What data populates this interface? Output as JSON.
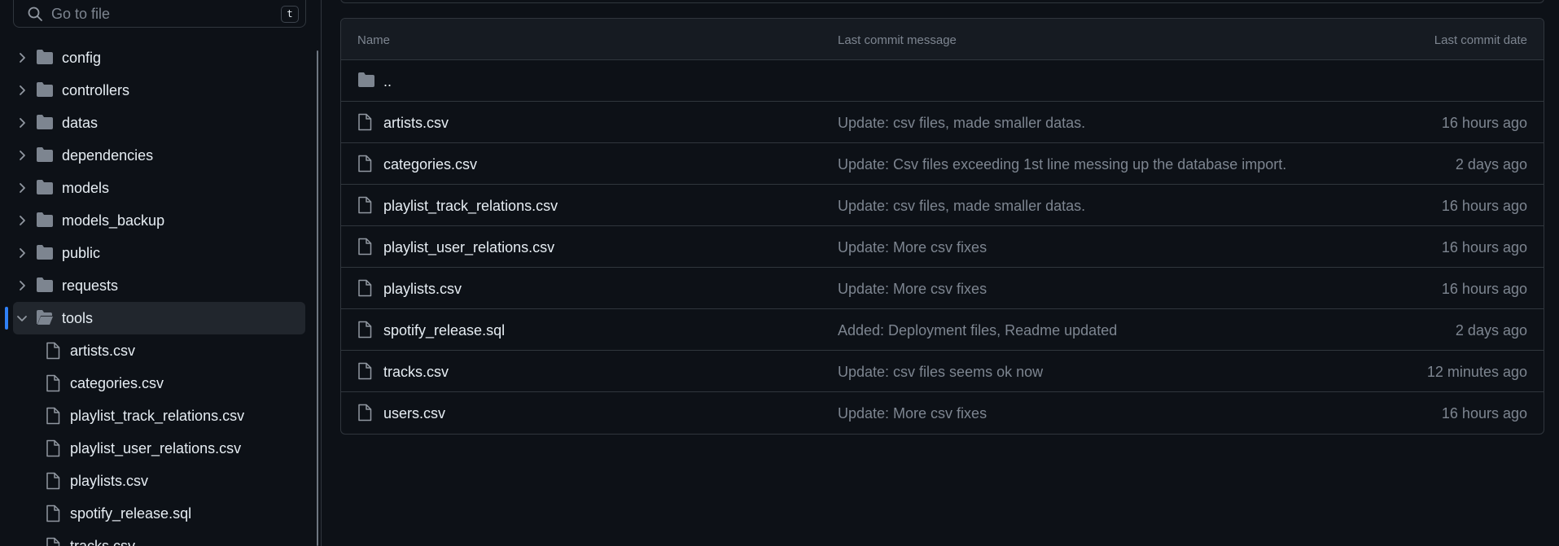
{
  "sidebar": {
    "search": {
      "placeholder": "Go to file",
      "shortcut": "t"
    },
    "folders": [
      {
        "label": "config"
      },
      {
        "label": "controllers"
      },
      {
        "label": "datas"
      },
      {
        "label": "dependencies"
      },
      {
        "label": "models"
      },
      {
        "label": "models_backup"
      },
      {
        "label": "public"
      },
      {
        "label": "requests"
      }
    ],
    "open_folder": {
      "label": "tools"
    },
    "files": [
      {
        "label": "artists.csv"
      },
      {
        "label": "categories.csv"
      },
      {
        "label": "playlist_track_relations.csv"
      },
      {
        "label": "playlist_user_relations.csv"
      },
      {
        "label": "playlists.csv"
      },
      {
        "label": "spotify_release.sql"
      },
      {
        "label": "tracks.csv"
      }
    ]
  },
  "table": {
    "headers": {
      "name": "Name",
      "message": "Last commit message",
      "date": "Last commit date"
    },
    "parent_dir": "..",
    "rows": [
      {
        "name": "artists.csv",
        "message": "Update: csv files, made smaller datas.",
        "date": "16 hours ago"
      },
      {
        "name": "categories.csv",
        "message": "Update: Csv files exceeding 1st line messing up the database import.",
        "date": "2 days ago"
      },
      {
        "name": "playlist_track_relations.csv",
        "message": "Update: csv files, made smaller datas.",
        "date": "16 hours ago"
      },
      {
        "name": "playlist_user_relations.csv",
        "message": "Update: More csv fixes",
        "date": "16 hours ago"
      },
      {
        "name": "playlists.csv",
        "message": "Update: More csv fixes",
        "date": "16 hours ago"
      },
      {
        "name": "spotify_release.sql",
        "message": "Added: Deployment files, Readme updated",
        "date": "2 days ago"
      },
      {
        "name": "tracks.csv",
        "message": "Update: csv files seems ok now",
        "date": "12 minutes ago"
      },
      {
        "name": "users.csv",
        "message": "Update: More csv fixes",
        "date": "16 hours ago"
      }
    ]
  },
  "colors": {
    "background": "#0d1117",
    "border": "#30363d",
    "muted_text": "#7d8590",
    "accent": "#2f81f7",
    "icon": "#7d8590"
  }
}
